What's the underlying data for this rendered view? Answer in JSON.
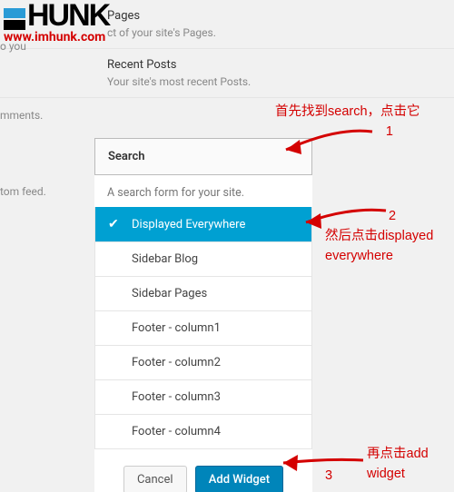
{
  "logo": {
    "brand": "HUNK",
    "url": "www.imhunk.com"
  },
  "background": {
    "rows": [
      {
        "title": "Pages",
        "desc": "ct of your site's Pages."
      },
      {
        "title": "Recent Posts",
        "desc": "Your site's most recent Posts."
      }
    ],
    "left_fragments": [
      "o you",
      "mments.",
      "tom feed."
    ]
  },
  "widget": {
    "title": "Search",
    "description": "A search form for your site.",
    "areas": [
      {
        "label": "Displayed Everywhere",
        "selected": true
      },
      {
        "label": "Sidebar Blog",
        "selected": false
      },
      {
        "label": "Sidebar Pages",
        "selected": false
      },
      {
        "label": "Footer - column1",
        "selected": false
      },
      {
        "label": "Footer - column2",
        "selected": false
      },
      {
        "label": "Footer - column3",
        "selected": false
      },
      {
        "label": "Footer - column4",
        "selected": false
      }
    ],
    "actions": {
      "cancel": "Cancel",
      "add": "Add Widget"
    }
  },
  "annotations": {
    "a1": {
      "text": "首先找到search，点击它",
      "num": "1"
    },
    "a2": {
      "text_line1": "然后点击displayed",
      "text_line2": "everywhere",
      "num": "2"
    },
    "a3": {
      "text_line1": "再点击add",
      "text_line2": "widget",
      "num": "3"
    }
  }
}
